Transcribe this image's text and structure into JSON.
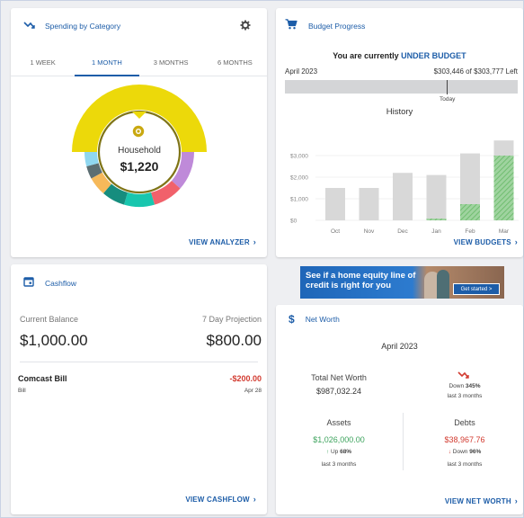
{
  "spending": {
    "title": "Spending by Category",
    "tabs": [
      "1 WEEK",
      "1 MONTH",
      "3 MONTHS",
      "6 MONTHS"
    ],
    "active_tab": 1,
    "center_label": "Household",
    "center_value": "$1,220",
    "link": "VIEW ANALYZER",
    "colors": {
      "household": "#ecd90a",
      "purple": "#bf8ad9",
      "red": "#f1616b",
      "teal": "#18c6ae",
      "dark_teal": "#168d7e",
      "orange": "#f6b95a",
      "gray": "#5c6e72",
      "light_blue": "#8fd7f0"
    }
  },
  "budget": {
    "title": "Budget Progress",
    "status_prefix": "You are currently",
    "status_value": "UNDER BUDGET",
    "month": "April 2023",
    "remaining": "$303,446 of $303,777 Left",
    "today_label": "Today",
    "history_title": "History",
    "link": "VIEW BUDGETS",
    "history": {
      "y_ticks": [
        "$3,000",
        "$2,000",
        "$1,000",
        "$0"
      ],
      "months": [
        "Oct",
        "Nov",
        "Dec",
        "Jan",
        "Feb",
        "Mar"
      ],
      "budget": [
        1500,
        1500,
        2200,
        2100,
        3100,
        3700
      ],
      "spent": [
        0,
        0,
        0,
        80,
        750,
        3000
      ]
    }
  },
  "cashflow": {
    "title": "Cashflow",
    "balance_label": "Current Balance",
    "balance_value": "$1,000.00",
    "projection_label": "7 Day Projection",
    "projection_value": "$800.00",
    "transaction": {
      "name": "Comcast Bill",
      "category": "Bill",
      "amount": "-$200.00",
      "date": "Apr 28"
    },
    "link": "VIEW CASHFLOW"
  },
  "ad": {
    "text": "See if a home equity line of credit is right for you",
    "button": "Get started >"
  },
  "net_worth": {
    "title": "Net Worth",
    "month": "April 2023",
    "total_label": "Total Net Worth",
    "total_value": "$987,032.24",
    "total_change_prefix": "Down",
    "total_change_pct": "345%",
    "period": "last 3 months",
    "assets_label": "Assets",
    "assets_value": "$1,026,000.00",
    "assets_change_prefix": "Up",
    "assets_change_pct": "68%",
    "debts_label": "Debts",
    "debts_value": "$38,967.76",
    "debts_change_prefix": "Down",
    "debts_change_pct": "96%",
    "link": "VIEW NET WORTH",
    "colors": {
      "positive": "#3da35d",
      "negative": "#d23b30"
    }
  }
}
